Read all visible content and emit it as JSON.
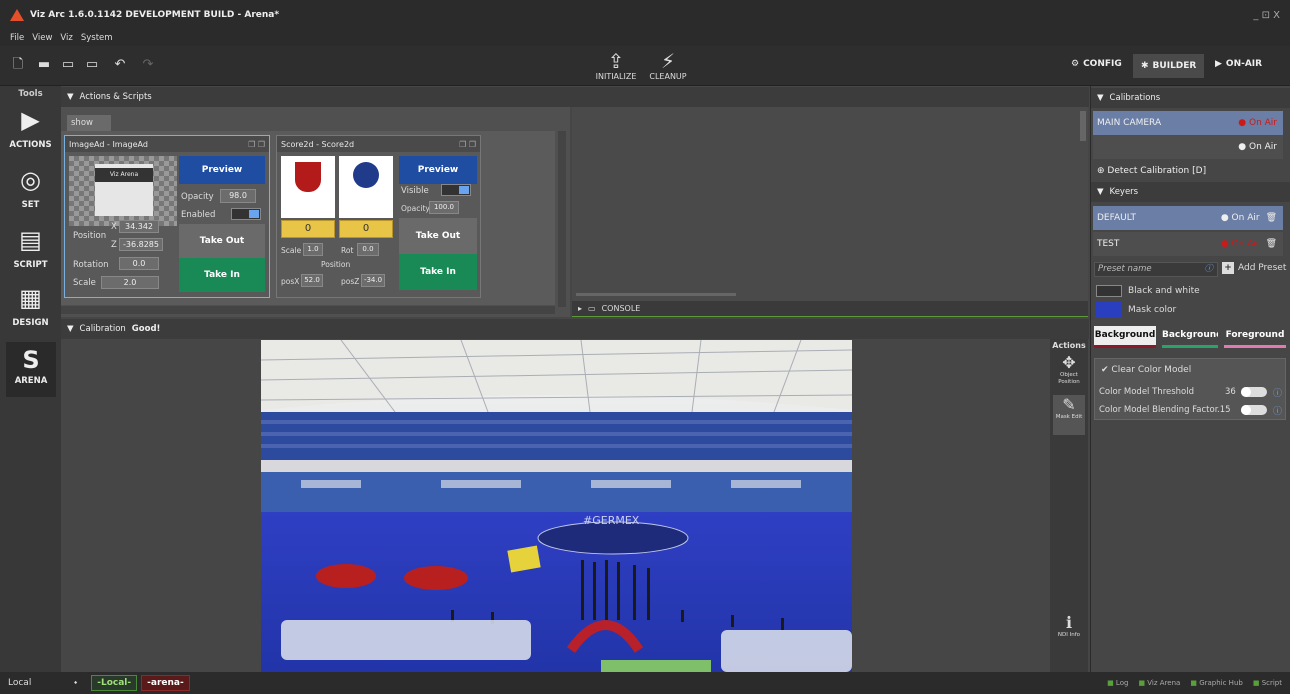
{
  "title": "Viz Arc 1.6.0.1142 DEVELOPMENT BUILD - Arena*",
  "window_controls": "_ ⊡ X",
  "menu": [
    "File",
    "View",
    "Viz",
    "System"
  ],
  "toolbar": {
    "initialize": "INITIALIZE",
    "cleanup": "CLEANUP",
    "config": "CONFIG",
    "builder": "BUILDER",
    "onair": "ON-AIR"
  },
  "tools": {
    "header": "Tools",
    "actions": "ACTIONS",
    "set": "SET",
    "script": "SCRIPT",
    "design": "DESIGN",
    "arena": "ARENA"
  },
  "actions_panel": {
    "title": "Actions & Scripts",
    "tab": "show",
    "console": "CONSOLE"
  },
  "imagead": {
    "title": "ImageAd - ImageAd",
    "thumb_text": "Viz Arena",
    "preview": "Preview",
    "opacity_label": "Opacity",
    "opacity": "98.0",
    "enabled_label": "Enabled",
    "position_label": "Position",
    "x_label": "X",
    "x": "34.342",
    "z_label": "Z",
    "z": "-36.8285",
    "rotation_label": "Rotation",
    "rotation": "0.0",
    "scale_label": "Scale",
    "scale": "2.0",
    "take_out": "Take Out",
    "take_in": "Take In"
  },
  "score2d": {
    "title": "Score2d - Score2d",
    "preview": "Preview",
    "visible_label": "Visible",
    "opacity_label": "Opacity",
    "opacity": "100.0",
    "score1": "0",
    "score2": "0",
    "scale_label": "Scale",
    "scale": "1.0",
    "rot_label": "Rot",
    "rot": "0.0",
    "position_label": "Position",
    "posx_label": "posX",
    "posx": "52.0",
    "posz_label": "posZ",
    "posz": "-34.0",
    "take_out": "Take Out",
    "take_in": "Take In"
  },
  "calibration_panel": {
    "title": "Calibration",
    "status": "Good!"
  },
  "viewport_actions": {
    "header": "Actions",
    "object_position": "Object Position",
    "mask_edit": "Mask Edit",
    "ndi_info": "NDI Info"
  },
  "right": {
    "calibrations_title": "Calibrations",
    "main_camera": "MAIN CAMERA",
    "on_air": "On Air",
    "detect": "Detect Calibration [D]",
    "keyers_title": "Keyers",
    "keyers": [
      {
        "name": "DEFAULT",
        "status": "On Air"
      },
      {
        "name": "TEST",
        "status": "On Air"
      }
    ],
    "preset_placeholder": "Preset name",
    "add_preset": "Add Preset",
    "black_white": "Black and white",
    "mask_color": "Mask color",
    "tabs": [
      "Background",
      "Background",
      "Foreground"
    ],
    "clear_color_model": "Clear Color Model",
    "threshold_label": "Color Model Threshold",
    "threshold": "36",
    "blending_label": "Color Model Blending Factor",
    "blending": ".15"
  },
  "status": {
    "local_select": "Local",
    "local_tag": "-Local-",
    "arena_tag": "-arena-",
    "log": "Log",
    "vizarena": "Viz Arena",
    "graphichub": "Graphic Hub",
    "script": "Script"
  },
  "colors": {
    "accent_blue": "#1f4da1",
    "green": "#198a55",
    "red": "#cc1a1a",
    "mask": "#2a3fbf"
  }
}
